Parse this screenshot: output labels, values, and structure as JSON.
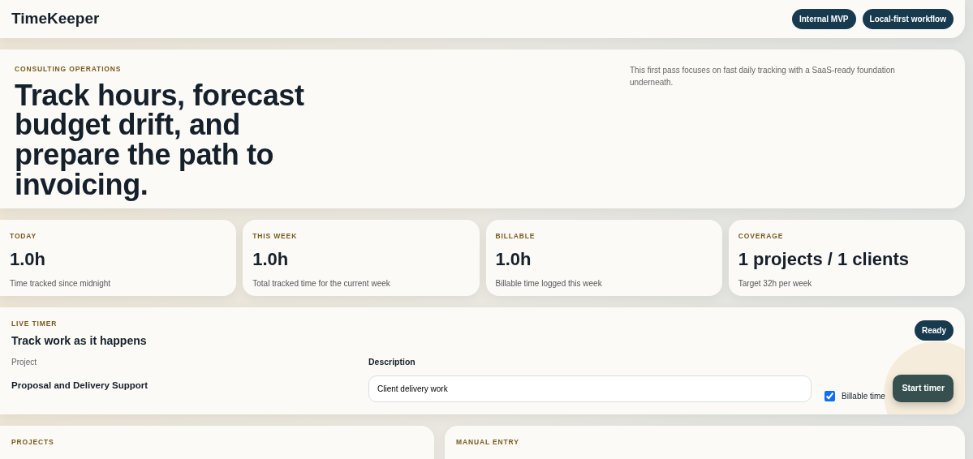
{
  "header": {
    "title": "TimeKeeper",
    "badges": [
      "Internal MVP",
      "Local-first workflow"
    ]
  },
  "hero": {
    "eyebrow": "CONSULTING OPERATIONS",
    "headline": "Track hours, forecast budget drift, and prepare the path to invoicing.",
    "note": "This first pass focuses on fast daily tracking with a SaaS-ready foundation underneath."
  },
  "stats": [
    {
      "label": "TODAY",
      "value": "1.0h",
      "caption": "Time tracked since midnight"
    },
    {
      "label": "THIS WEEK",
      "value": "1.0h",
      "caption": "Total tracked time for the current week"
    },
    {
      "label": "BILLABLE",
      "value": "1.0h",
      "caption": "Billable time logged this week"
    },
    {
      "label": "COVERAGE",
      "value": "1 projects / 1 clients",
      "caption": "Target 32h per week"
    }
  ],
  "timer": {
    "eyebrow": "LIVE TIMER",
    "title": "Track work as it happens",
    "status": "Ready",
    "project_label": "Project",
    "project": "Proposal and Delivery Support",
    "description_label": "Description",
    "description": "Client delivery work",
    "billable_label": "Billable time",
    "billable_checked": true,
    "button": "Start timer"
  },
  "panels": [
    {
      "eyebrow": "PROJECTS"
    },
    {
      "eyebrow": "MANUAL ENTRY"
    }
  ]
}
